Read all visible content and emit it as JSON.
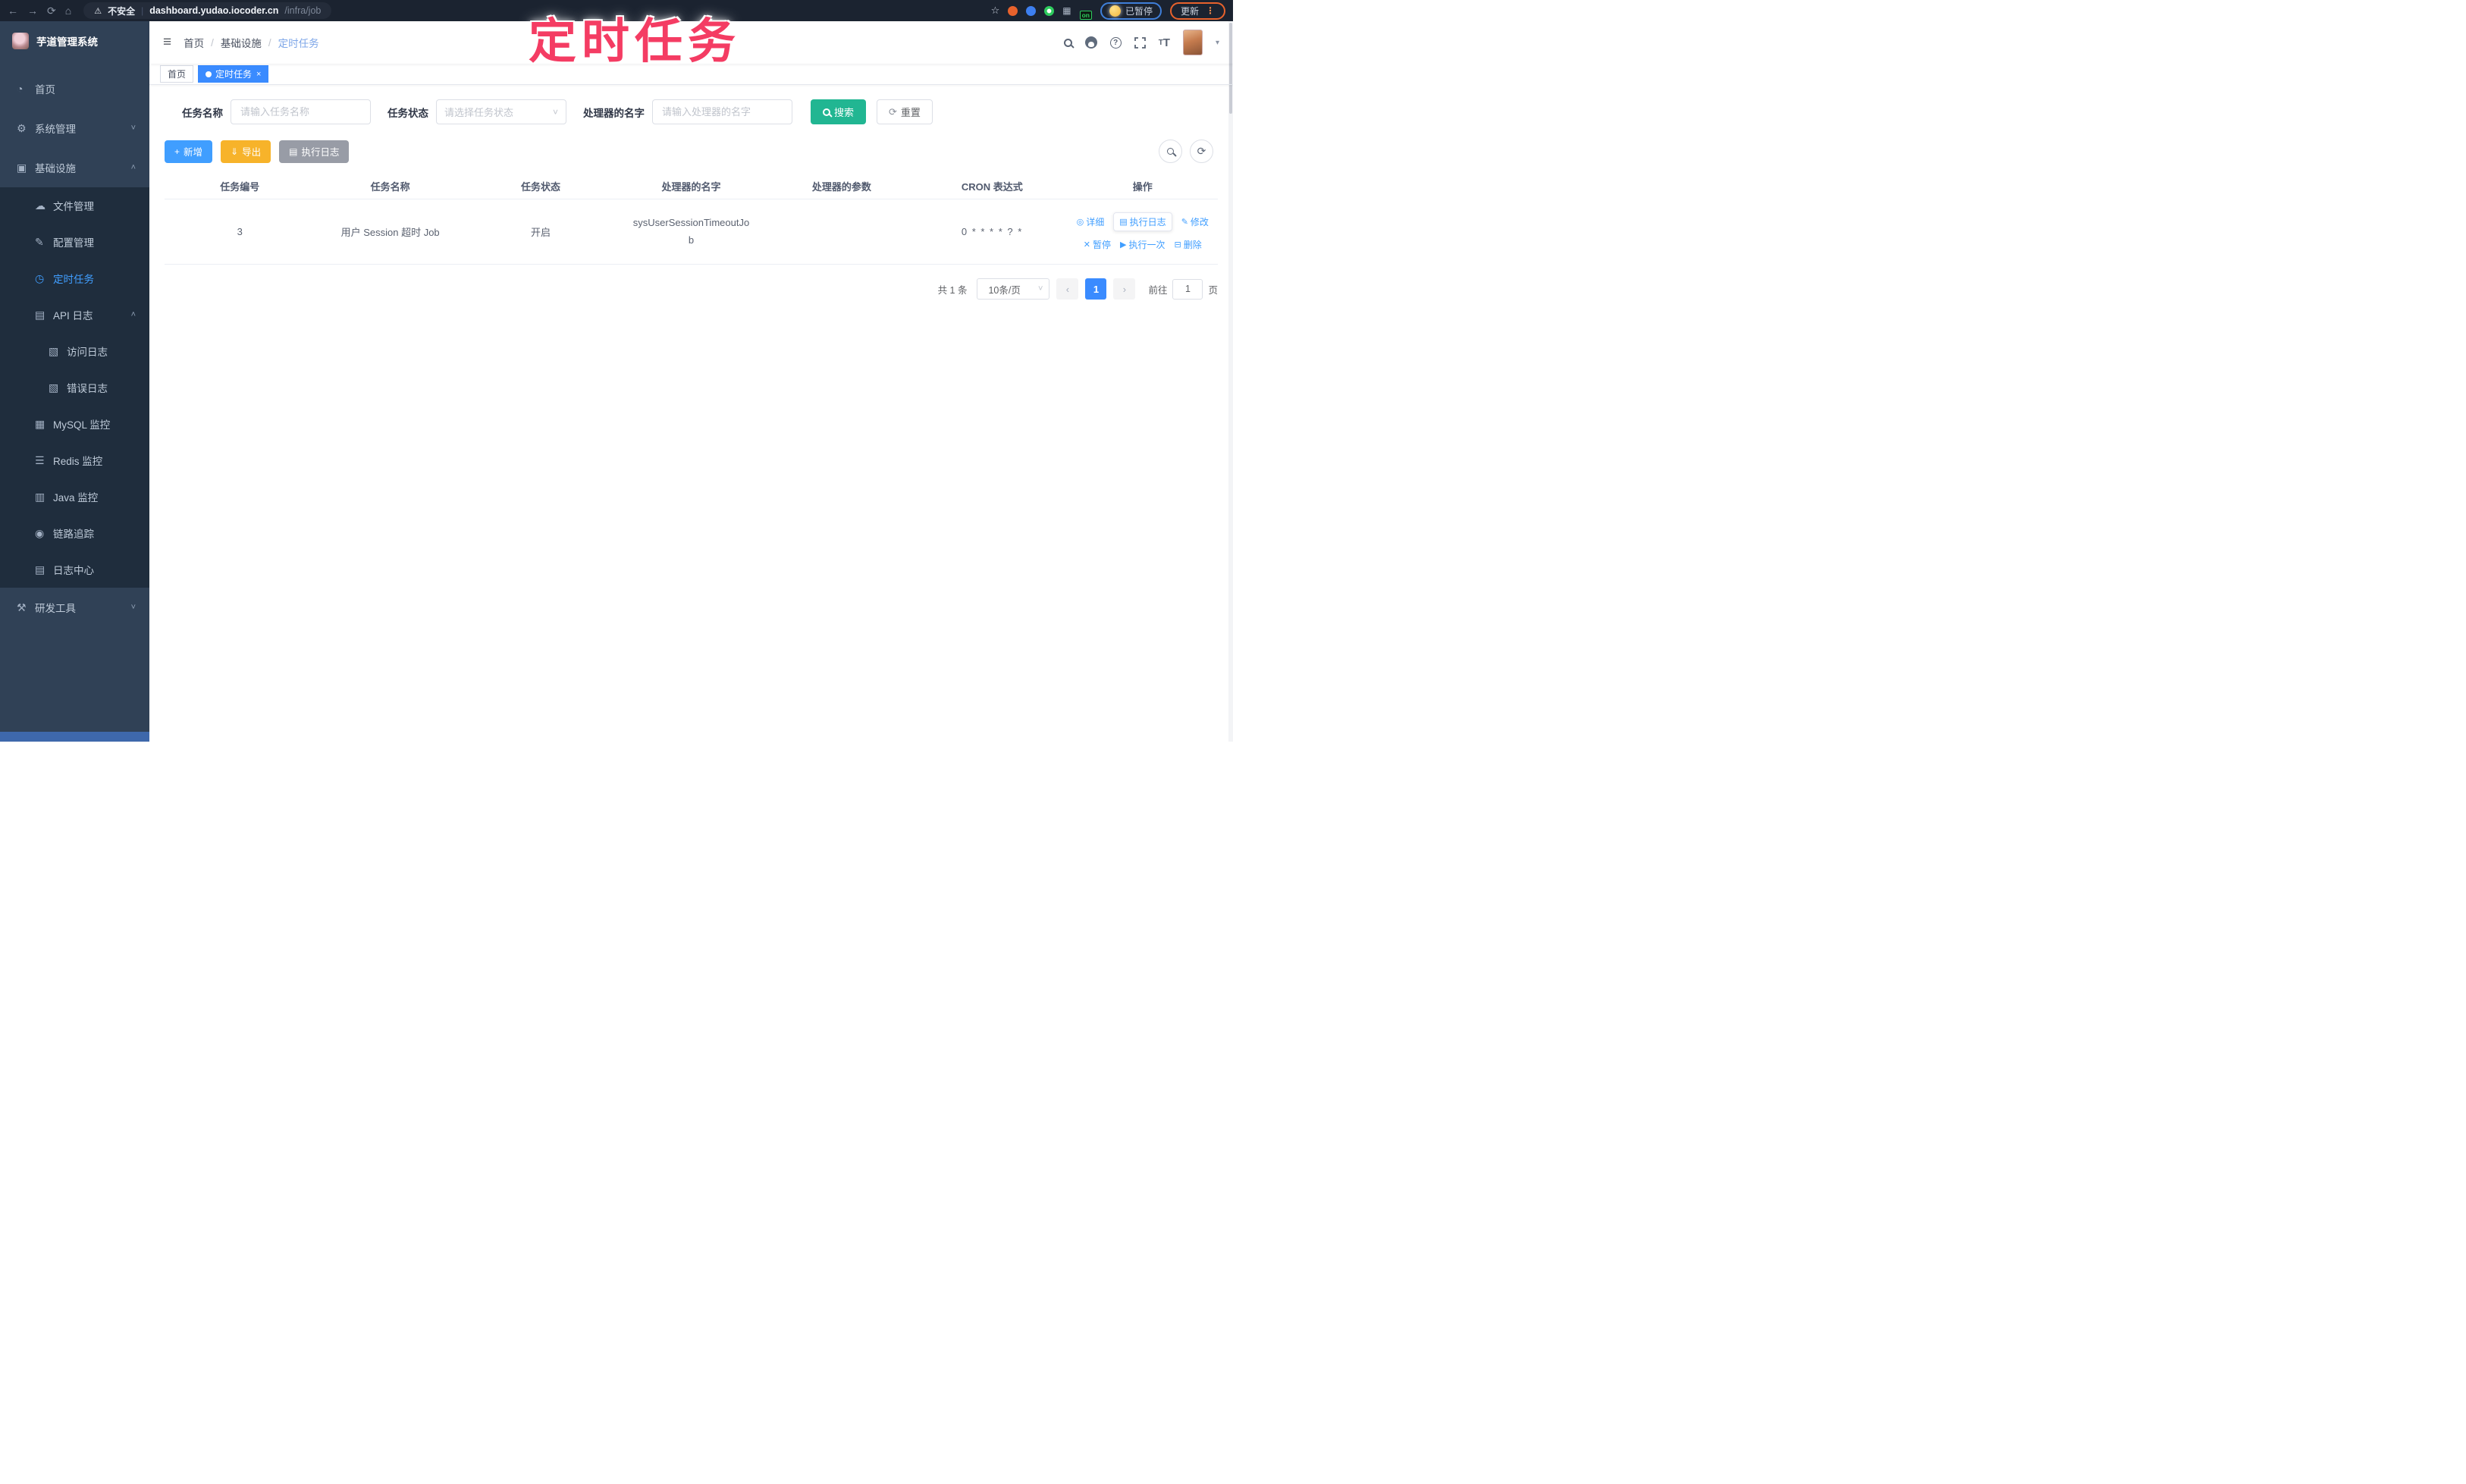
{
  "browser": {
    "security": "不安全",
    "url_host": "dashboard.yudao.iocoder.cn",
    "url_path": "/infra/job",
    "on_badge": "on",
    "profile_status": "已暂停",
    "update_label": "更新"
  },
  "glyphs": {
    "back": "←",
    "forward": "→",
    "reload": "⟳",
    "home": "⌂",
    "warning": "⚠",
    "divider": "|",
    "star": "☆",
    "grid": "▦",
    "dots": "⋮",
    "hamburger": "≡",
    "slash": "/",
    "caret": "▾",
    "chevron_down": "˅",
    "chevron_up": "˄",
    "plus": "+",
    "download": "⇓",
    "list": "▤",
    "refresh": "⟳",
    "prev": "‹",
    "next": "›",
    "close": "×",
    "help": "?",
    "font_big": "T",
    "font_small": "T"
  },
  "annotation": {
    "text": "定时任务"
  },
  "sidebar": {
    "logo_title": "芋道管理系统",
    "items": [
      {
        "label": "首页",
        "glyph": "◔"
      },
      {
        "label": "系统管理",
        "glyph": "⚙",
        "chevron": "˅"
      },
      {
        "label": "基础设施",
        "glyph": "▣",
        "chevron": "˄"
      },
      {
        "label": "文件管理",
        "glyph": "☁"
      },
      {
        "label": "配置管理",
        "glyph": "✎"
      },
      {
        "label": "定时任务",
        "glyph": "◷"
      },
      {
        "label": "API 日志",
        "glyph": "▤",
        "chevron": "˄"
      },
      {
        "label": "访问日志",
        "glyph": "▧"
      },
      {
        "label": "错误日志",
        "glyph": "▧"
      },
      {
        "label": "MySQL 监控",
        "glyph": "▦"
      },
      {
        "label": "Redis 监控",
        "glyph": "☰"
      },
      {
        "label": "Java 监控",
        "glyph": "▥"
      },
      {
        "label": "链路追踪",
        "glyph": "◉"
      },
      {
        "label": "日志中心",
        "glyph": "▤"
      },
      {
        "label": "研发工具",
        "glyph": "⚒",
        "chevron": "˅"
      }
    ]
  },
  "breadcrumb": {
    "items": [
      "首页",
      "基础设施",
      "定时任务"
    ]
  },
  "tabs": [
    {
      "label": "首页"
    },
    {
      "label": "定时任务"
    }
  ],
  "filters": {
    "name_label": "任务名称",
    "name_placeholder": "请输入任务名称",
    "status_label": "任务状态",
    "status_placeholder": "请选择任务状态",
    "handler_label": "处理器的名字",
    "handler_placeholder": "请输入处理器的名字",
    "search_label": "搜索",
    "reset_label": "重置"
  },
  "toolbar": {
    "add_label": "新增",
    "export_label": "导出",
    "exec_log_label": "执行日志"
  },
  "table": {
    "headers": [
      "任务编号",
      "任务名称",
      "任务状态",
      "处理器的名字",
      "处理器的参数",
      "CRON 表达式",
      "操作"
    ],
    "row": {
      "id": "3",
      "name": "用户 Session 超时 Job",
      "status": "开启",
      "handler": "sysUserSessionTimeoutJob",
      "param": "",
      "cron": "0 * * * * ? *"
    },
    "ops": [
      {
        "icon": "◎",
        "label": "详细"
      },
      {
        "icon": "▤",
        "label": "执行日志"
      },
      {
        "icon": "✎",
        "label": "修改"
      },
      {
        "icon": "✕",
        "label": "暂停"
      },
      {
        "icon": "▶",
        "label": "执行一次"
      },
      {
        "icon": "⊟",
        "label": "删除"
      }
    ]
  },
  "pagination": {
    "total": "共 1 条",
    "page_size": "10条/页",
    "current_page": "1",
    "goto_prefix": "前往",
    "goto_value": "1",
    "goto_suffix": "页"
  }
}
